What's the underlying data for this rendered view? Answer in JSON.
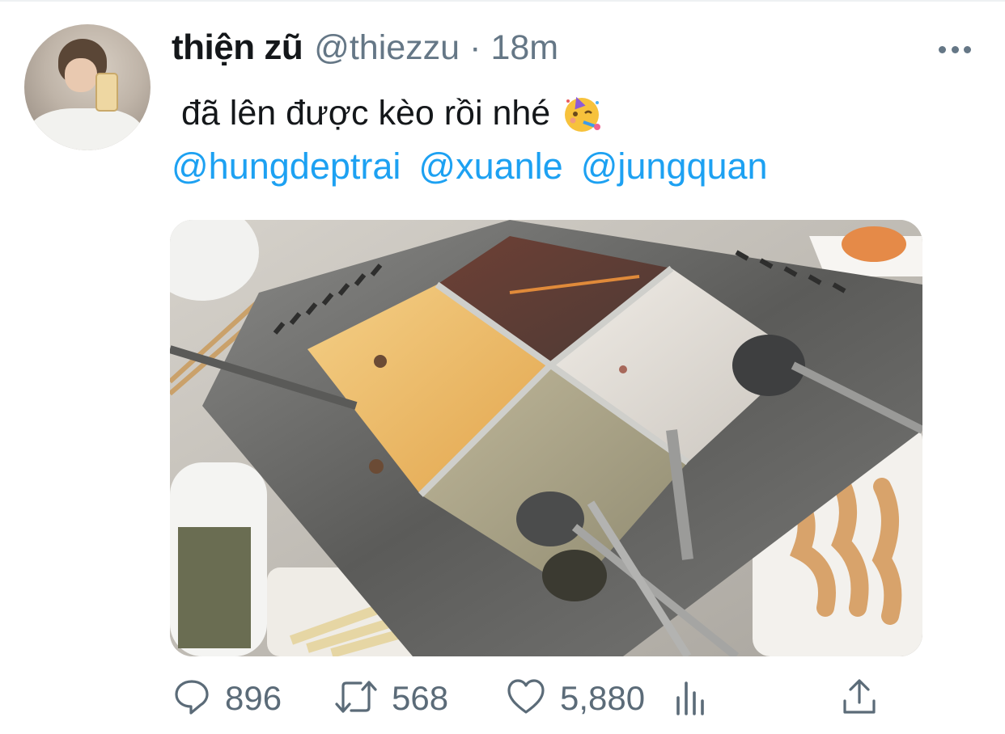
{
  "tweet": {
    "display_name": "thiện zũ",
    "handle": "@thiezzu",
    "separator": "·",
    "time": "18m",
    "text": "đã lên được kèo rồi nhé",
    "emoji": "partying-face-emoji",
    "mentions": [
      "@hungdeptrai",
      "@xuanle",
      "@jungquan"
    ]
  },
  "actions": {
    "replies": "896",
    "retweets": "568",
    "likes": "5,880"
  },
  "icons": {
    "more": "more-horizontal-icon",
    "reply": "reply-icon",
    "retweet": "retweet-icon",
    "like": "heart-icon",
    "analytics": "analytics-icon",
    "share": "share-icon"
  },
  "colors": {
    "link": "#1da1f2",
    "text": "#14171a",
    "secondary": "#657786"
  }
}
